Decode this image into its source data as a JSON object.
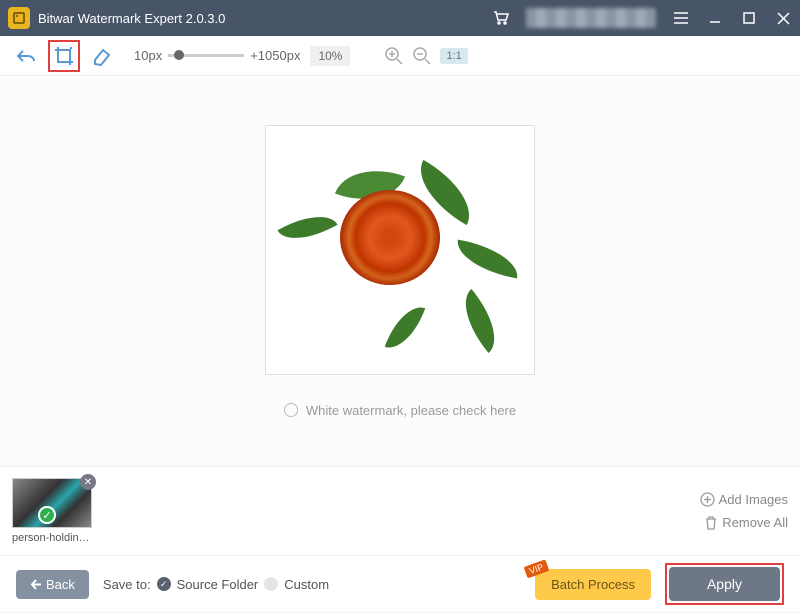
{
  "titlebar": {
    "title": "Bitwar Watermark Expert  2.0.3.0"
  },
  "toolbar": {
    "min_px": "10px",
    "max_px": "+1050px",
    "zoom_pct": "10%",
    "ratio": "1:1"
  },
  "watermark_check": "White watermark, please check here",
  "thumb": {
    "label": "person-holding-fil..."
  },
  "actions": {
    "add": "Add Images",
    "remove": "Remove All"
  },
  "bottom": {
    "back": "Back",
    "saveto": "Save to:",
    "source": "Source Folder",
    "custom": "Custom",
    "batch": "Batch Process",
    "vip": "VIP",
    "apply": "Apply"
  }
}
